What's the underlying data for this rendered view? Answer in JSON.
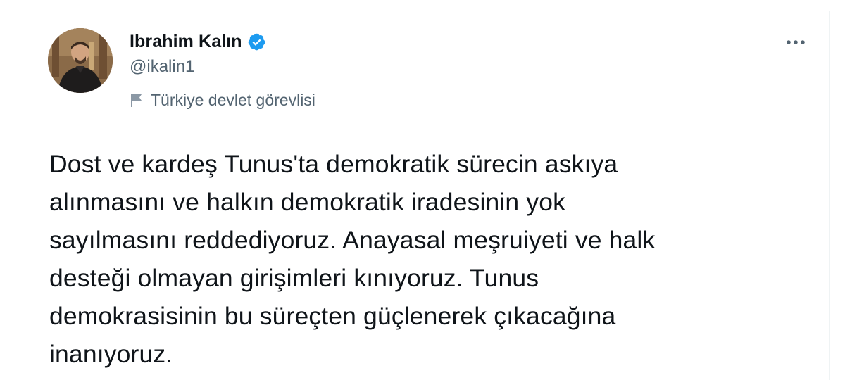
{
  "tweet": {
    "author": {
      "display_name": "Ibrahim Kalın",
      "handle": "@ikalin1",
      "verified": true,
      "account_label": "Türkiye devlet görevlisi"
    },
    "text": "Dost ve kardeş Tunus'ta demokratik sürecin askıya\nalınmasını ve halkın demokratik iradesinin yok\nsayılmasını reddediyoruz. Anayasal meşruiyeti ve halk\ndesteği olmayan girişimleri kınıyoruz. Tunus\ndemokrasisinin bu süreçten güçlenerek çıkacağına\ninanıyoruz."
  },
  "icons": {
    "verified": "verified-badge-icon",
    "label": "flag-icon",
    "menu": "more-options-icon"
  },
  "colors": {
    "verified_blue": "#1d9bf0",
    "secondary_text": "#536471",
    "primary_text": "#0f1419",
    "border": "#eff3f4"
  }
}
